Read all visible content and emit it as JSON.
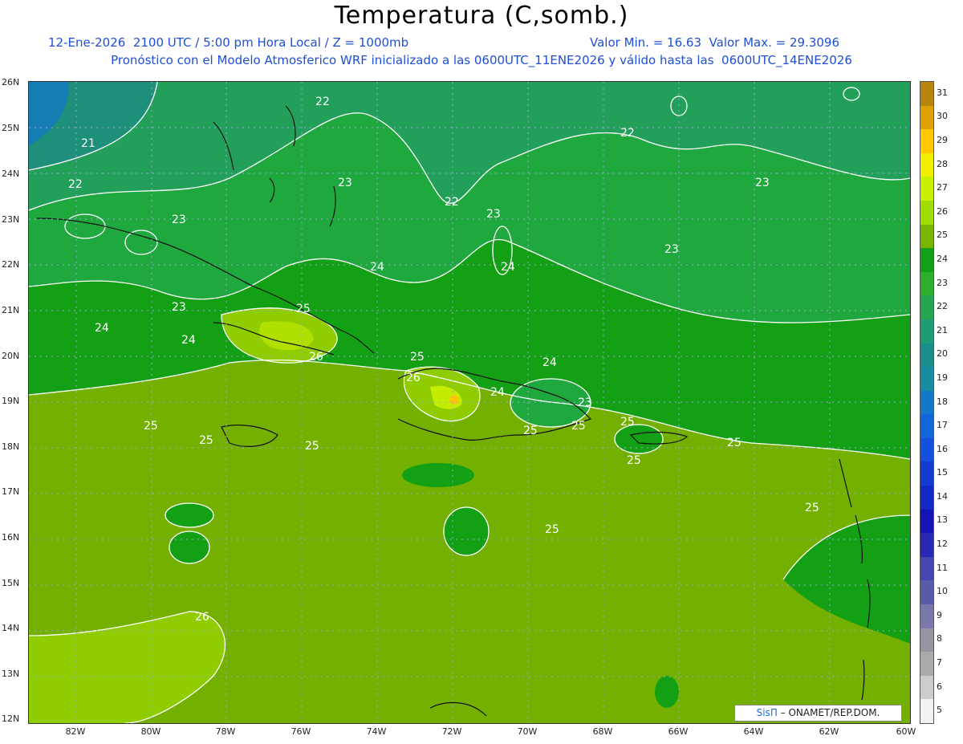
{
  "header": {
    "title": "Temperatura (C,somb.)",
    "line1_left": "12-Ene-2026  2100 UTC / 5:00 pm Hora Local / Z = 1000mb",
    "line1_right": "Valor Min. = 16.63  Valor Max. = 29.3096",
    "line2": "Pronóstico con el Modelo Atmosferico WRF inicializado a las 0600UTC_11ENE2026 y válido hasta las  0600UTC_14ENE2026"
  },
  "axes": {
    "lat_labels": [
      "26N",
      "25N",
      "24N",
      "23N",
      "22N",
      "21N",
      "20N",
      "19N",
      "18N",
      "17N",
      "16N",
      "15N",
      "14N",
      "13N",
      "12N"
    ],
    "lon_labels": [
      "82W",
      "80W",
      "78W",
      "76W",
      "74W",
      "72W",
      "70W",
      "68W",
      "66W",
      "64W",
      "62W",
      "60W"
    ]
  },
  "contour_labels": [
    "22",
    "21",
    "22",
    "23",
    "23",
    "22",
    "23",
    "23",
    "24",
    "22",
    "23",
    "25",
    "24",
    "23",
    "24",
    "24",
    "25",
    "26",
    "26",
    "25",
    "24",
    "24",
    "23",
    "25",
    "25",
    "25",
    "25",
    "25",
    "25",
    "25",
    "25",
    "25",
    "26"
  ],
  "colorbar": {
    "labels": [
      "31",
      "30",
      "29",
      "28",
      "27",
      "26",
      "25",
      "24",
      "23",
      "22",
      "21",
      "20",
      "19",
      "18",
      "17",
      "16",
      "15",
      "14",
      "13",
      "12",
      "11",
      "10",
      "9",
      "8",
      "7",
      "6",
      "5"
    ],
    "colors": [
      "#b8860b",
      "#e0a000",
      "#ffc800",
      "#f0f000",
      "#c8f000",
      "#a0dc00",
      "#78b400",
      "#14a014",
      "#2dae2d",
      "#26a650",
      "#1e9c78",
      "#1a8c8c",
      "#168ca0",
      "#1478c8",
      "#1464dc",
      "#1450dc",
      "#143cd2",
      "#1428c8",
      "#1414b4",
      "#2828b4",
      "#4646b4",
      "#5a5aaa",
      "#7878aa",
      "#9696a0",
      "#aaaaaa",
      "#cccccc",
      "#f2f2f2"
    ]
  },
  "credit": {
    "brand": "SisΠ",
    "text": "– ONAMET/REP.DOM."
  },
  "colors": {
    "title_text": "#1f4fd6",
    "water_high": "#7fb800",
    "water_mid": "#1ea31e"
  }
}
